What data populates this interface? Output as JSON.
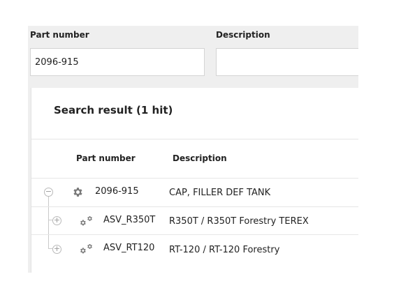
{
  "search": {
    "part_number_label": "Part number",
    "part_number_value": "2096-915",
    "description_label": "Description",
    "description_value": ""
  },
  "results": {
    "title": "Search result (1 hit)",
    "columns": {
      "part_number": "Part number",
      "description": "Description"
    },
    "rows": [
      {
        "part_number": "2096-915",
        "description": "CAP, FILLER DEF TANK",
        "toggle": "−",
        "icon": "gear-icon"
      },
      {
        "part_number": "ASV_R350T",
        "description": "R350T / R350T Forestry TEREX",
        "toggle": "+",
        "icon": "gears-icon"
      },
      {
        "part_number": "ASV_RT120",
        "description": "RT-120 / RT-120 Forestry",
        "toggle": "+",
        "icon": "gears-icon"
      }
    ]
  }
}
